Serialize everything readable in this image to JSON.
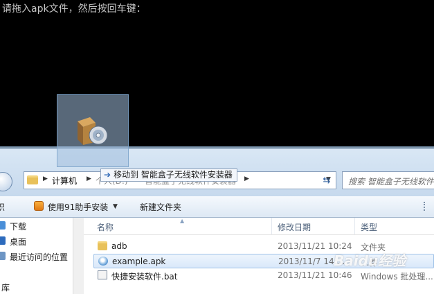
{
  "console": {
    "prompt_text": "请拖入apk文件，然后按回车键："
  },
  "address_bar": {
    "crumbs": [
      "计算机",
      "个人(D:)",
      "智能盒子无线软件安装器"
    ],
    "search_placeholder": "搜索 智能盒子无线软件"
  },
  "toolbar": {
    "partial_left": "织",
    "install_91_label": "使用91助手安装",
    "new_folder_label": "新建文件夹"
  },
  "nav_pane": {
    "items": [
      {
        "label": "下载",
        "icon": "download-folder-icon"
      },
      {
        "label": "桌面",
        "icon": "desktop-icon"
      },
      {
        "label": "最近访问的位置",
        "icon": "recent-places-icon"
      }
    ],
    "library_label": "库"
  },
  "file_list": {
    "columns": {
      "name": "名称",
      "date": "修改日期",
      "type": "类型"
    },
    "rows": [
      {
        "name": "adb",
        "date": "2013/11/21 10:24",
        "type": "文件夹",
        "icon": "folder-icon",
        "selected": false
      },
      {
        "name": "example.apk",
        "date": "2013/11/7 14:...",
        "type": "...件",
        "icon": "apk-icon",
        "selected": true
      },
      {
        "name": "快捷安装软件.bat",
        "date": "2013/11/21 10:46",
        "type": "Windows 批处理...",
        "icon": "bat-icon",
        "selected": false
      }
    ]
  },
  "drag_tooltip": {
    "text": "移动到 智能盒子无线软件安装器"
  },
  "watermark": {
    "text": "Baidu经验"
  }
}
